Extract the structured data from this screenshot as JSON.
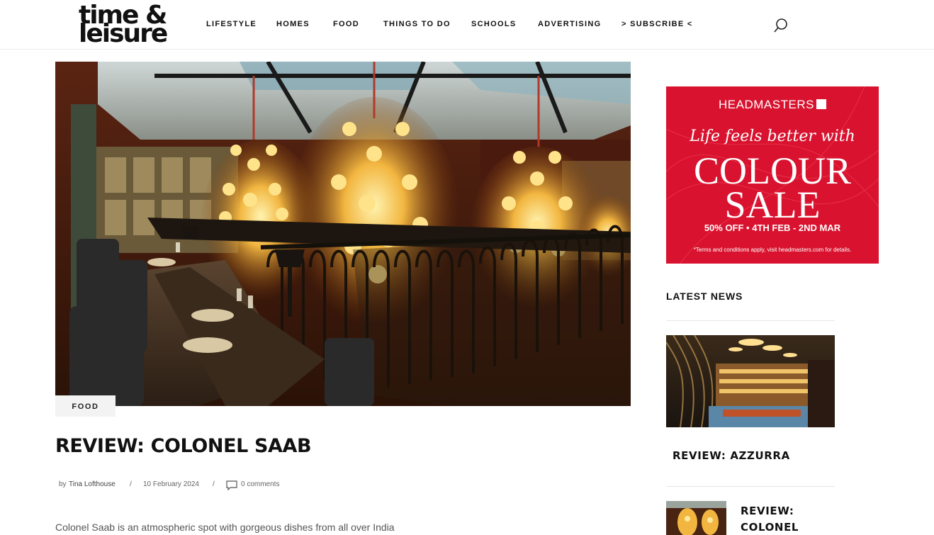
{
  "header": {
    "logo_line1": "time &",
    "logo_line2": "leisure",
    "nav": [
      {
        "label": "LIFESTYLE"
      },
      {
        "label": "HOMES"
      },
      {
        "label": "FOOD"
      },
      {
        "label": "THINGS TO DO"
      },
      {
        "label": "SCHOOLS"
      },
      {
        "label": "ADVERTISING"
      },
      {
        "label": "> SUBSCRIBE <"
      }
    ],
    "search_icon": "search-icon"
  },
  "article": {
    "category": "FOOD",
    "title": "REVIEW: COLONEL SAAB",
    "by": "by",
    "author": "Tina Lofthouse",
    "separator": "/",
    "date": "10 February 2024",
    "comments": "0 comments",
    "excerpt": "Colonel Saab is an atmospheric spot with gorgeous dishes from all over India"
  },
  "ad": {
    "brand": "HEADMASTERS",
    "tagline": "Life feels better with",
    "sale_line1": "COLOUR",
    "sale_line2": "SALE",
    "offer": "50% OFF • 4TH FEB - 2ND MAR",
    "terms": "*Terms and conditions apply, visit headmasters.com for details.",
    "color": "#d9132f"
  },
  "sidebar": {
    "latest_heading": "LATEST NEWS",
    "items": [
      {
        "title": "REVIEW: AZZURRA"
      },
      {
        "title": "REVIEW: COLONEL"
      }
    ]
  }
}
